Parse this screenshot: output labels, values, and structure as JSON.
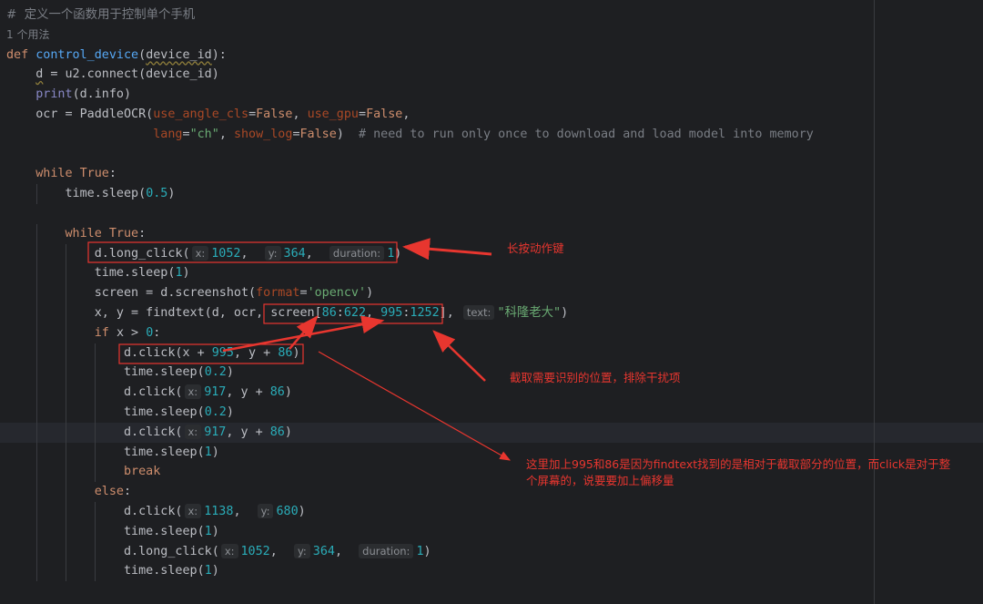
{
  "colors": {
    "background": "#1e1f22",
    "annotation": "#e8362f"
  },
  "lines": [
    {
      "indent": 0,
      "tokens": [
        [
          "#  定义一个函数用于控制单个手机",
          "cmt cmt-cn"
        ]
      ]
    },
    {
      "indent": 0,
      "tokens": [
        [
          "1 个用法",
          "usage"
        ]
      ]
    },
    {
      "indent": 0,
      "tokens": [
        [
          "def ",
          "kw"
        ],
        [
          "control_device",
          "fn"
        ],
        [
          "(",
          ""
        ],
        [
          "device_id",
          "warn"
        ],
        [
          "):",
          ""
        ]
      ]
    },
    {
      "indent": 1,
      "tokens": [
        [
          "d",
          "warn"
        ],
        [
          " = u2.connect(device_id)",
          ""
        ]
      ]
    },
    {
      "indent": 1,
      "tokens": [
        [
          "print",
          "builtin"
        ],
        [
          "(d.info)",
          ""
        ]
      ]
    },
    {
      "indent": 1,
      "tokens": [
        [
          "ocr = PaddleOCR(",
          ""
        ],
        [
          "use_angle_cls",
          "param"
        ],
        [
          "=",
          ""
        ],
        [
          "False",
          "kw"
        ],
        [
          ", ",
          ""
        ],
        [
          "use_gpu",
          "param"
        ],
        [
          "=",
          ""
        ],
        [
          "False",
          "kw"
        ],
        [
          ",",
          ""
        ]
      ]
    },
    {
      "indent": 1,
      "tokens": [
        [
          "                ",
          ""
        ],
        [
          "lang",
          "param"
        ],
        [
          "=",
          ""
        ],
        [
          "\"ch\"",
          "str"
        ],
        [
          ", ",
          ""
        ],
        [
          "show_log",
          "param"
        ],
        [
          "=",
          ""
        ],
        [
          "False",
          "kw"
        ],
        [
          ")  ",
          ""
        ],
        [
          "# need to run only once to download and load model into memory",
          "cmt"
        ]
      ]
    },
    {
      "indent": 0,
      "tokens": []
    },
    {
      "indent": 1,
      "tokens": [
        [
          "while ",
          "kw"
        ],
        [
          "True",
          "kw"
        ],
        [
          ":",
          ""
        ]
      ]
    },
    {
      "indent": 2,
      "tokens": [
        [
          "time.sleep(",
          ""
        ],
        [
          "0.5",
          "num"
        ],
        [
          ")",
          ""
        ]
      ]
    },
    {
      "indent": 0,
      "tokens": []
    },
    {
      "indent": 2,
      "tokens": [
        [
          "while ",
          "kw"
        ],
        [
          "True",
          "kw"
        ],
        [
          ":",
          ""
        ]
      ]
    },
    {
      "indent": 3,
      "tokens": [
        [
          "d.long_click(",
          ""
        ],
        [
          "x:",
          "hint"
        ],
        [
          "1052",
          "num"
        ],
        [
          ",  ",
          ""
        ],
        [
          "y:",
          "hint"
        ],
        [
          "364",
          "num"
        ],
        [
          ",  ",
          ""
        ],
        [
          "duration:",
          "hint"
        ],
        [
          "1",
          "num"
        ],
        [
          ")",
          ""
        ]
      ]
    },
    {
      "indent": 3,
      "tokens": [
        [
          "time.sleep(",
          ""
        ],
        [
          "1",
          "num"
        ],
        [
          ")",
          ""
        ]
      ]
    },
    {
      "indent": 3,
      "tokens": [
        [
          "screen = d.screenshot(",
          ""
        ],
        [
          "format",
          "param"
        ],
        [
          "=",
          ""
        ],
        [
          "'opencv'",
          "str"
        ],
        [
          ")",
          ""
        ]
      ]
    },
    {
      "indent": 3,
      "tokens": [
        [
          "x, y = findtext(d, ocr, screen[",
          ""
        ],
        [
          "86",
          "num"
        ],
        [
          ":",
          ""
        ],
        [
          "622",
          "num"
        ],
        [
          ", ",
          ""
        ],
        [
          "995",
          "num"
        ],
        [
          ":",
          ""
        ],
        [
          "1252",
          "num"
        ],
        [
          "], ",
          ""
        ],
        [
          "text:",
          "hint"
        ],
        [
          "\"科隆老大\"",
          "str"
        ],
        [
          ")",
          ""
        ]
      ]
    },
    {
      "indent": 3,
      "tokens": [
        [
          "if ",
          "kw"
        ],
        [
          "x > ",
          ""
        ],
        [
          "0",
          "num"
        ],
        [
          ":",
          ""
        ]
      ]
    },
    {
      "indent": 4,
      "tokens": [
        [
          "d.click(x + ",
          ""
        ],
        [
          "995",
          "num"
        ],
        [
          ", y + ",
          ""
        ],
        [
          "86",
          "num"
        ],
        [
          ")",
          ""
        ]
      ]
    },
    {
      "indent": 4,
      "tokens": [
        [
          "time.sleep(",
          ""
        ],
        [
          "0.2",
          "num"
        ],
        [
          ")",
          ""
        ]
      ]
    },
    {
      "indent": 4,
      "tokens": [
        [
          "d.click(",
          ""
        ],
        [
          "x:",
          "hint"
        ],
        [
          "917",
          "num"
        ],
        [
          ", y + ",
          ""
        ],
        [
          "86",
          "num"
        ],
        [
          ")",
          ""
        ]
      ]
    },
    {
      "indent": 4,
      "tokens": [
        [
          "time.sleep(",
          ""
        ],
        [
          "0.2",
          "num"
        ],
        [
          ")",
          ""
        ]
      ]
    },
    {
      "indent": 4,
      "current": true,
      "tokens": [
        [
          "d.click(",
          ""
        ],
        [
          "x:",
          "hint"
        ],
        [
          "917",
          "num"
        ],
        [
          ", y + ",
          ""
        ],
        [
          "86",
          "num"
        ],
        [
          ")",
          ""
        ]
      ]
    },
    {
      "indent": 4,
      "tokens": [
        [
          "time.sleep(",
          ""
        ],
        [
          "1",
          "num"
        ],
        [
          ")",
          ""
        ]
      ]
    },
    {
      "indent": 4,
      "tokens": [
        [
          "break",
          "kw"
        ]
      ]
    },
    {
      "indent": 3,
      "tokens": [
        [
          "else",
          "kw"
        ],
        [
          ":",
          ""
        ]
      ]
    },
    {
      "indent": 4,
      "tokens": [
        [
          "d.click(",
          ""
        ],
        [
          "x:",
          "hint"
        ],
        [
          "1138",
          "num"
        ],
        [
          ",  ",
          ""
        ],
        [
          "y:",
          "hint"
        ],
        [
          "680",
          "num"
        ],
        [
          ")",
          ""
        ]
      ]
    },
    {
      "indent": 4,
      "tokens": [
        [
          "time.sleep(",
          ""
        ],
        [
          "1",
          "num"
        ],
        [
          ")",
          ""
        ]
      ]
    },
    {
      "indent": 4,
      "tokens": [
        [
          "d.long_click(",
          ""
        ],
        [
          "x:",
          "hint"
        ],
        [
          "1052",
          "num"
        ],
        [
          ",  ",
          ""
        ],
        [
          "y:",
          "hint"
        ],
        [
          "364",
          "num"
        ],
        [
          ",  ",
          ""
        ],
        [
          "duration:",
          "hint"
        ],
        [
          "1",
          "num"
        ],
        [
          ")",
          ""
        ]
      ]
    },
    {
      "indent": 4,
      "tokens": [
        [
          "time.sleep(",
          ""
        ],
        [
          "1",
          "num"
        ],
        [
          ")",
          ""
        ]
      ]
    }
  ],
  "annotations": {
    "long_press": "长按动作键",
    "crop_region": "截取需要识别的位置，排除干扰项",
    "offset_line1": "这里加上995和86是因为findtext找到的是相对于截取部分的位置，而click是对于整",
    "offset_line2": "个屏幕的，说要要加上偏移量"
  }
}
